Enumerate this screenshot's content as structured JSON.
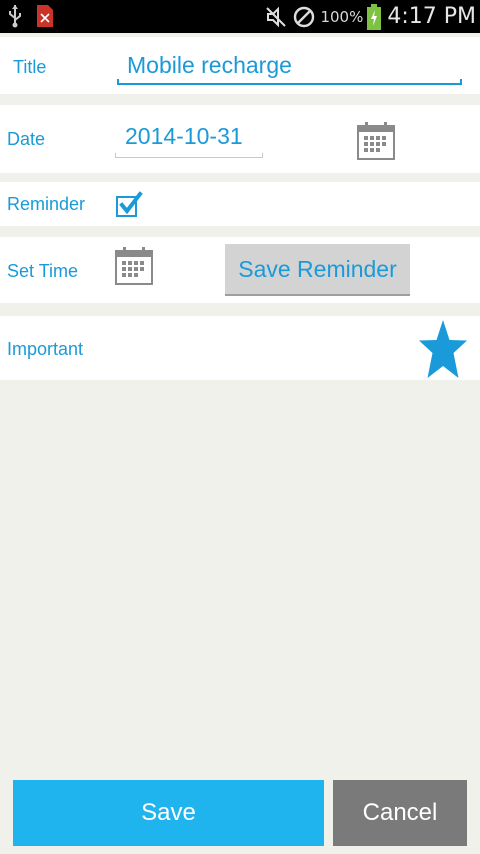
{
  "status_bar": {
    "battery_percent": "100%",
    "time": "4:17 PM",
    "icons": [
      "usb-icon",
      "notification-x-icon",
      "mute-icon",
      "no-signal-icon",
      "battery-charging-icon"
    ]
  },
  "form": {
    "title_label": "Title",
    "title_value": "Mobile recharge",
    "date_label": "Date",
    "date_value": "2014-10-31",
    "reminder_label": "Reminder",
    "reminder_checked": true,
    "set_time_label": "Set Time",
    "save_reminder_label": "Save Reminder",
    "important_label": "Important",
    "important_starred": true
  },
  "actions": {
    "save_label": "Save",
    "cancel_label": "Cancel"
  },
  "colors": {
    "accent": "#1a9ad9",
    "save_button": "#20b4ee",
    "cancel_button": "#7a7a7a",
    "background": "#f1f1ec"
  }
}
